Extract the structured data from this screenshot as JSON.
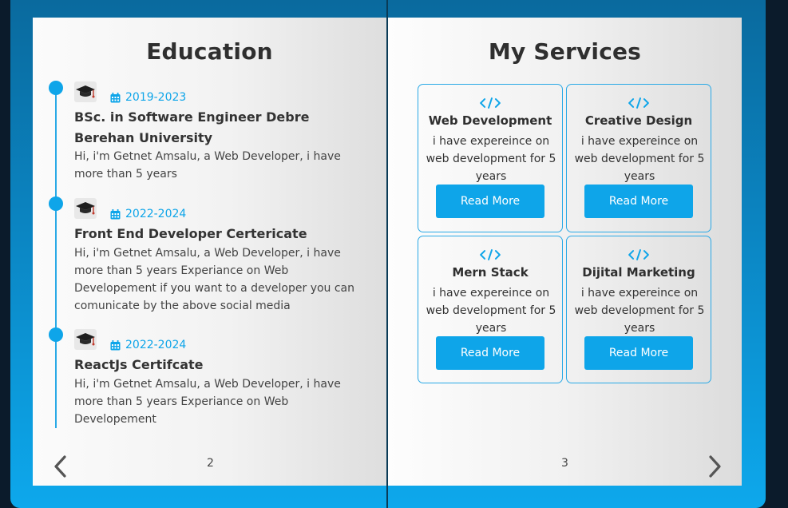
{
  "left_page": {
    "title": "Education",
    "page_number": "2",
    "items": [
      {
        "date": "2019-2023",
        "title": "BSc. in Software Engineer Debre Berehan University",
        "description": "Hi, i'm Getnet Amsalu, a Web Developer, i have more than 5 years"
      },
      {
        "date": "2022-2024",
        "title": "Front End Developer Certericate",
        "description": "Hi, i'm Getnet Amsalu, a Web Developer, i have more than 5 years Experiance on Web Developement if you want to a developer you can comunicate by the above social media"
      },
      {
        "date": "2022-2024",
        "title": "ReactJs Certifcate",
        "description": "Hi, i'm Getnet Amsalu, a Web Developer, i have more than 5 years Experiance on Web Developement"
      }
    ]
  },
  "right_page": {
    "title": "My Services",
    "page_number": "3",
    "services": [
      {
        "icon": "code-icon",
        "title": "Web Development",
        "description": "i have expereince on web development for 5 years",
        "button": "Read More"
      },
      {
        "icon": "code-icon",
        "title": "Creative Design",
        "description": "i have expereince on web development for 5 years",
        "button": "Read More"
      },
      {
        "icon": "code-icon",
        "title": "Mern Stack",
        "description": "i have expereince on web development for 5 years",
        "button": "Read More"
      },
      {
        "icon": "code-icon",
        "title": "Dijital Marketing",
        "description": "i have expereince on web development for 5 years",
        "button": "Read More"
      }
    ]
  },
  "navigation": {
    "prev_icon": "chevron-left-icon",
    "next_icon": "chevron-right-icon"
  },
  "colors": {
    "accent": "#0ea5e9",
    "frame": "#0b85c2",
    "heading": "#2f2f2f"
  }
}
